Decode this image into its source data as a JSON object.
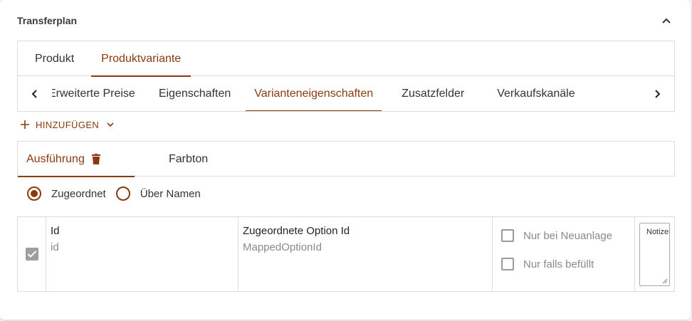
{
  "header": {
    "title": "Transferplan"
  },
  "outer_tabs": [
    {
      "label": "Produkt",
      "active": false
    },
    {
      "label": "Produktvariante",
      "active": true
    }
  ],
  "inner_tabs": [
    {
      "label": "Erweiterte Preise",
      "active": false
    },
    {
      "label": "Eigenschaften",
      "active": false
    },
    {
      "label": "Varianteneigenschaften",
      "active": true
    },
    {
      "label": "Zusatzfelder",
      "active": false
    },
    {
      "label": "Verkaufskanäle",
      "active": false
    }
  ],
  "actions": {
    "add_label": "HINZUFÜGEN"
  },
  "attribute_tabs": [
    {
      "label": "Ausführung",
      "active": true
    },
    {
      "label": "Farbton",
      "active": false
    }
  ],
  "mapping_mode": {
    "options": [
      "Zugeordnet",
      "Über Namen"
    ],
    "selected": "Zugeordnet"
  },
  "row": {
    "checked": true,
    "id_label": "Id",
    "id_value": "id",
    "mapped_label": "Zugeordnete Option Id",
    "mapped_value": "MappedOptionId",
    "flag_new_only": "Nur bei Neuanlage",
    "flag_if_filled": "Nur falls befüllt",
    "note_placeholder": "Notizen"
  },
  "colors": {
    "accent": "#8b3a0e",
    "border": "#dcdcdc",
    "muted_text": "#8a8a8a"
  },
  "icons": {
    "collapse": "chevron-up-icon",
    "scroll_left": "chevron-left-icon",
    "scroll_right": "chevron-right-icon",
    "add": "plus-icon",
    "add_menu": "chevron-down-icon",
    "delete": "trash-icon",
    "checkbox": "check-icon"
  }
}
